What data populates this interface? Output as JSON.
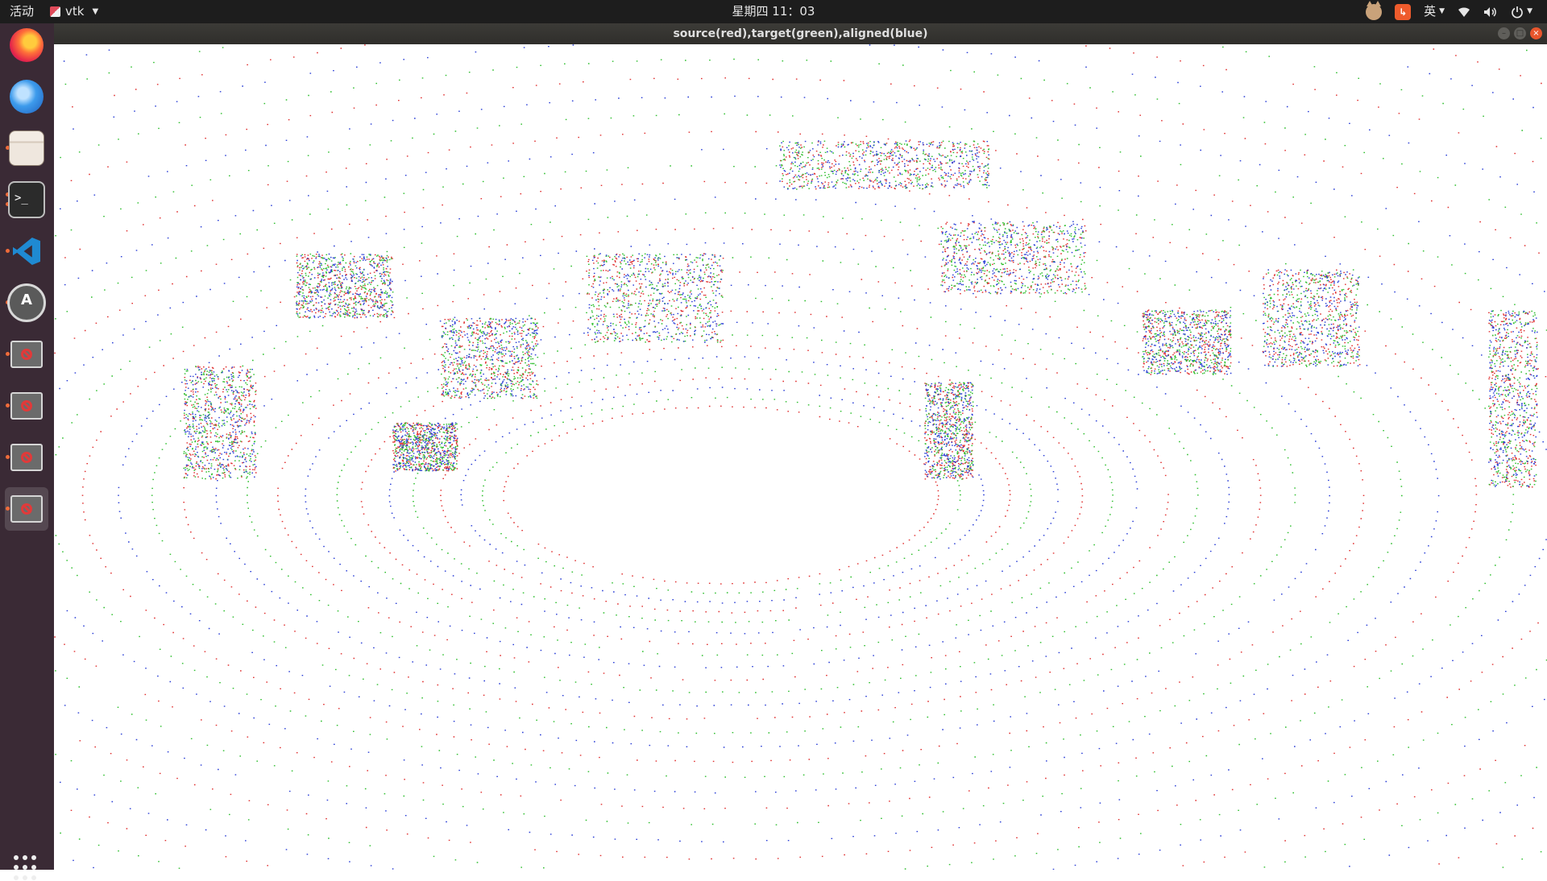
{
  "topbar": {
    "activities": "活动",
    "app_name": "vtk",
    "clock": "星期四 11：03",
    "input_method": "英"
  },
  "window": {
    "title": "source(red),target(green),aligned(blue)"
  },
  "dock": {
    "items": [
      "firefox-icon",
      "thunderbird-icon",
      "files-icon",
      "terminal-icon",
      "vscode-icon",
      "software-updater-icon",
      "blocked-app-icon",
      "blocked-app-icon",
      "blocked-app-icon",
      "blocked-app-icon"
    ]
  },
  "viewport": {
    "background": "#ffffff",
    "colors": {
      "source": "#e03030",
      "target": "#2fbf2f",
      "aligned": "#2a3fd6"
    }
  }
}
